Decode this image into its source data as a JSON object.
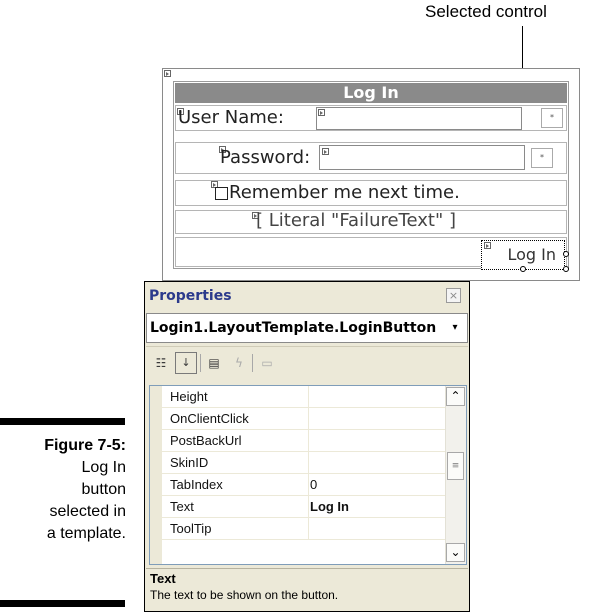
{
  "callout": {
    "text": "Selected control"
  },
  "designer": {
    "title": "Log In",
    "username_label": "User Name:",
    "password_label": "Password:",
    "remember_label": "Remember me next time.",
    "literal_text": "[ Literal \"FailureText\" ]",
    "login_button": "Log In",
    "validator_marker": "*"
  },
  "properties": {
    "title": "Properties",
    "close_glyph": "×",
    "object": "Login1.LayoutTemplate.LoginButton",
    "rows": [
      {
        "name": "Height",
        "value": ""
      },
      {
        "name": "OnClientClick",
        "value": ""
      },
      {
        "name": "PostBackUrl",
        "value": ""
      },
      {
        "name": "SkinID",
        "value": ""
      },
      {
        "name": "TabIndex",
        "value": "0"
      },
      {
        "name": "Text",
        "value": "Log In"
      },
      {
        "name": "ToolTip",
        "value": ""
      }
    ],
    "description_title": "Text",
    "description_text": "The text to be shown on the button."
  },
  "caption": {
    "label": "Figure 7-5:",
    "lines": [
      "Log In",
      "button",
      "selected in",
      "a template."
    ]
  }
}
